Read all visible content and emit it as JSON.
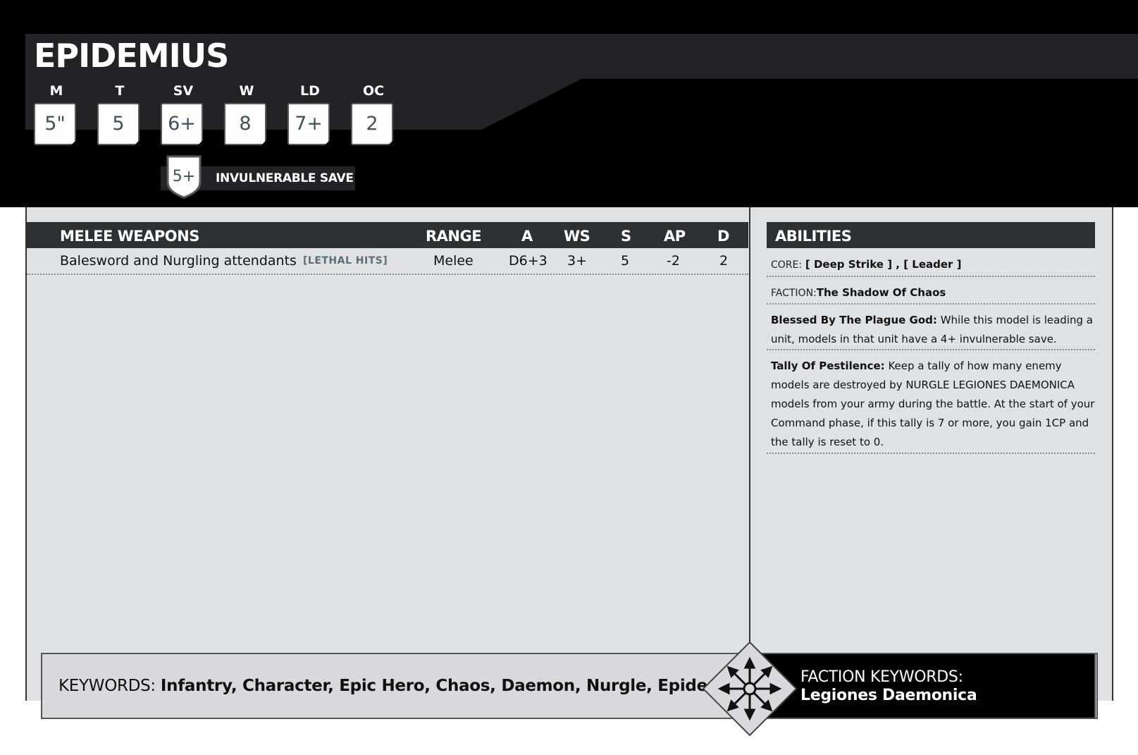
{
  "unit": {
    "name": "EPIDEMIUS"
  },
  "stats": [
    {
      "label": "M",
      "value": "5\""
    },
    {
      "label": "T",
      "value": "5"
    },
    {
      "label": "SV",
      "value": "6+"
    },
    {
      "label": "W",
      "value": "8"
    },
    {
      "label": "LD",
      "value": "7+"
    },
    {
      "label": "OC",
      "value": "2"
    }
  ],
  "invulnerable": {
    "value": "5+",
    "label": "INVULNERABLE SAVE"
  },
  "melee": {
    "headers": {
      "name": "MELEE WEAPONS",
      "range": "RANGE",
      "a": "A",
      "ws": "WS",
      "s": "S",
      "ap": "AP",
      "d": "D"
    },
    "rows": [
      {
        "name": "Balesword and Nurgling attendants",
        "keyword": "[LETHAL HITS]",
        "range": "Melee",
        "a": "D6+3",
        "ws": "3+",
        "s": "5",
        "ap": "-2",
        "d": "2"
      }
    ]
  },
  "abilities": {
    "title": "ABILITIES",
    "core_prefix": "CORE:",
    "core_value": "[ Deep Strike ] , [ Leader ]",
    "faction_prefix": "FACTION:",
    "faction_value": "The Shadow Of Chaos",
    "items": [
      {
        "name": "Blessed By The Plague God:",
        "text": "While this model is leading a unit, models in that unit have a 4+ invulnerable save."
      },
      {
        "name": "Tally Of Pestilence:",
        "text": "Keep a tally of how many enemy models are destroyed by NURGLE LEGIONES DAEMONICA models from your army during the battle. At the start of your Command phase, if this tally is 7 or more, you gain 1CP and the tally is reset to 0."
      }
    ]
  },
  "keywords": {
    "label": "KEYWORDS:",
    "values": "Infantry, Character, Epic Hero, Chaos, Daemon, Nurgle, Epidemius"
  },
  "faction_keywords": {
    "label": "FACTION KEYWORDS:",
    "value": "Legiones Daemonica"
  },
  "icons": {
    "emblem": "chaos-star-icon",
    "shield": "shield-icon"
  },
  "colors": {
    "header_bg": "#000000",
    "header_band": "#232325",
    "card_bg": "#e0e1e3",
    "stat_value": "#3f5154",
    "table_header": "#2f3034"
  }
}
